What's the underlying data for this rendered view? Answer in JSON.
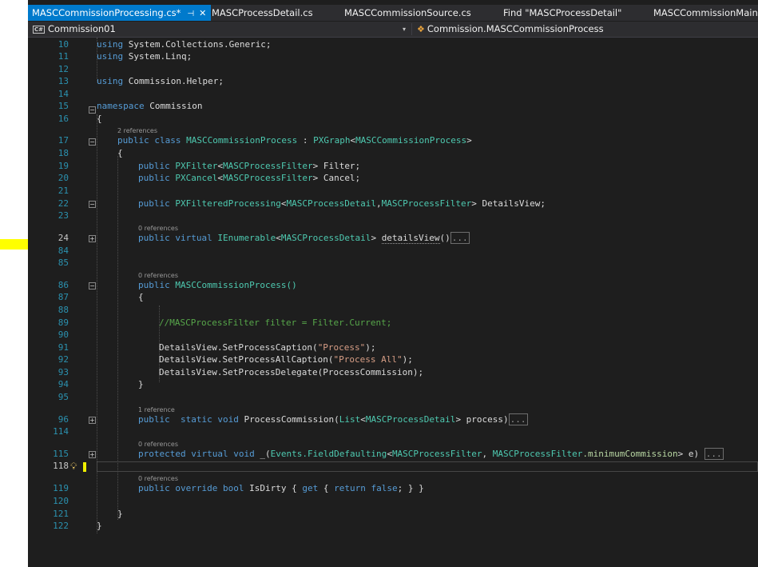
{
  "tabs": [
    {
      "label": "MASCCommissionProcessing.cs*",
      "pin": "⊣",
      "close": "✕"
    },
    {
      "label": "MASCProcessDetail.cs"
    },
    {
      "label": "MASCCommissionSource.cs"
    },
    {
      "label": "Find \"MASCProcessDetail\""
    },
    {
      "label": "MASCCommissionMaint"
    }
  ],
  "navbar": {
    "project_badge": "C#",
    "project": "Commission01",
    "dropdown_arrow": "▾",
    "member_icon": "class-icon",
    "member_icon_glyph": "❖",
    "member": "Commission.MASCCommissionProcess"
  },
  "line_numbers": [
    "10",
    "11",
    "12",
    "13",
    "14",
    "15",
    "16",
    "17",
    "18",
    "19",
    "20",
    "21",
    "22",
    "23",
    "24",
    "84",
    "85",
    "86",
    "87",
    "88",
    "89",
    "90",
    "91",
    "92",
    "93",
    "94",
    "95",
    "96",
    "114",
    "115",
    "118",
    "119",
    "120",
    "121",
    "122"
  ],
  "lens": {
    "class_refs": "2 references",
    "detailsview_refs": "0 references",
    "ctor_refs": "0 references",
    "process_refs": "1 reference",
    "defaulting_refs": "0 references",
    "isdirty_refs": "0 references"
  },
  "code": {
    "kw_using": "using",
    "kw_namespace": "namespace",
    "kw_public": "public",
    "kw_class": "class",
    "kw_virtual": "virtual",
    "kw_static": "static",
    "kw_void": "void",
    "kw_protected": "protected",
    "kw_override": "override",
    "kw_bool": "bool",
    "kw_get": "get",
    "kw_return": "return",
    "kw_false": "false",
    "ns_collections": " System.Collections.Generic;",
    "ns_linq": " System.Linq;",
    "ns_helper": " Commission.Helper;",
    "ns_name": " Commission",
    "open_brace": "{",
    "close_brace": "}",
    "class_name": "MASCCommissionProcess",
    "colon": " : ",
    "pxgraph": "PXGraph",
    "lt": "<",
    "gt": ">",
    "pxfilter": "PXFilter",
    "pxcancel": "PXCancel",
    "filter_type": "MASCProcessFilter",
    "filter_decl_rest": "> Filter;",
    "cancel_decl_rest": "> Cancel;",
    "pxfilteredprocessing": "PXFilteredProcessing",
    "detail_type": "MASCProcessDetail",
    "comma": ",",
    "detailsview_decl_rest": "> DetailsView;",
    "ienumerable": "IEnumerable",
    "detailsview_method": "detailsView",
    "detailsview_parens": "()",
    "collapsed_marker": "...",
    "ctor_sig": "MASCCommissionProcess()",
    "comment_filter": "//MASCProcessFilter filter = Filter.Current;",
    "call_caption_pre": "DetailsView.SetProcessCaption(",
    "str_process": "\"Process\"",
    "call_end": ");",
    "call_allcaption_pre": "DetailsView.SetProcessAllCaption(",
    "str_process_all": "\"Process All\"",
    "call_delegate": "DetailsView.SetProcessDelegate(ProcessCommission);",
    "process_method": " ProcessCommission(",
    "list_type": "List",
    "process_param": "> process)",
    "defaulting_method": " _(",
    "events": "Events",
    "field_defaulting": ".FieldDefaulting",
    "min_commission": ".minimumCommission",
    "comma_space": ", ",
    "defaulting_param": "> e) ",
    "isdirty_name": " IsDirty { ",
    "semicolon_close": "; } }"
  },
  "colors": {
    "editor_bg": "#1e1e1e",
    "active_tab": "#007acc",
    "keyword": "#569cd6",
    "type": "#4ec9b0",
    "type_param": "#b8d7a3",
    "string": "#d69d85",
    "comment": "#57a64a",
    "line_number": "#2b91af",
    "marker": "#ffff00"
  }
}
